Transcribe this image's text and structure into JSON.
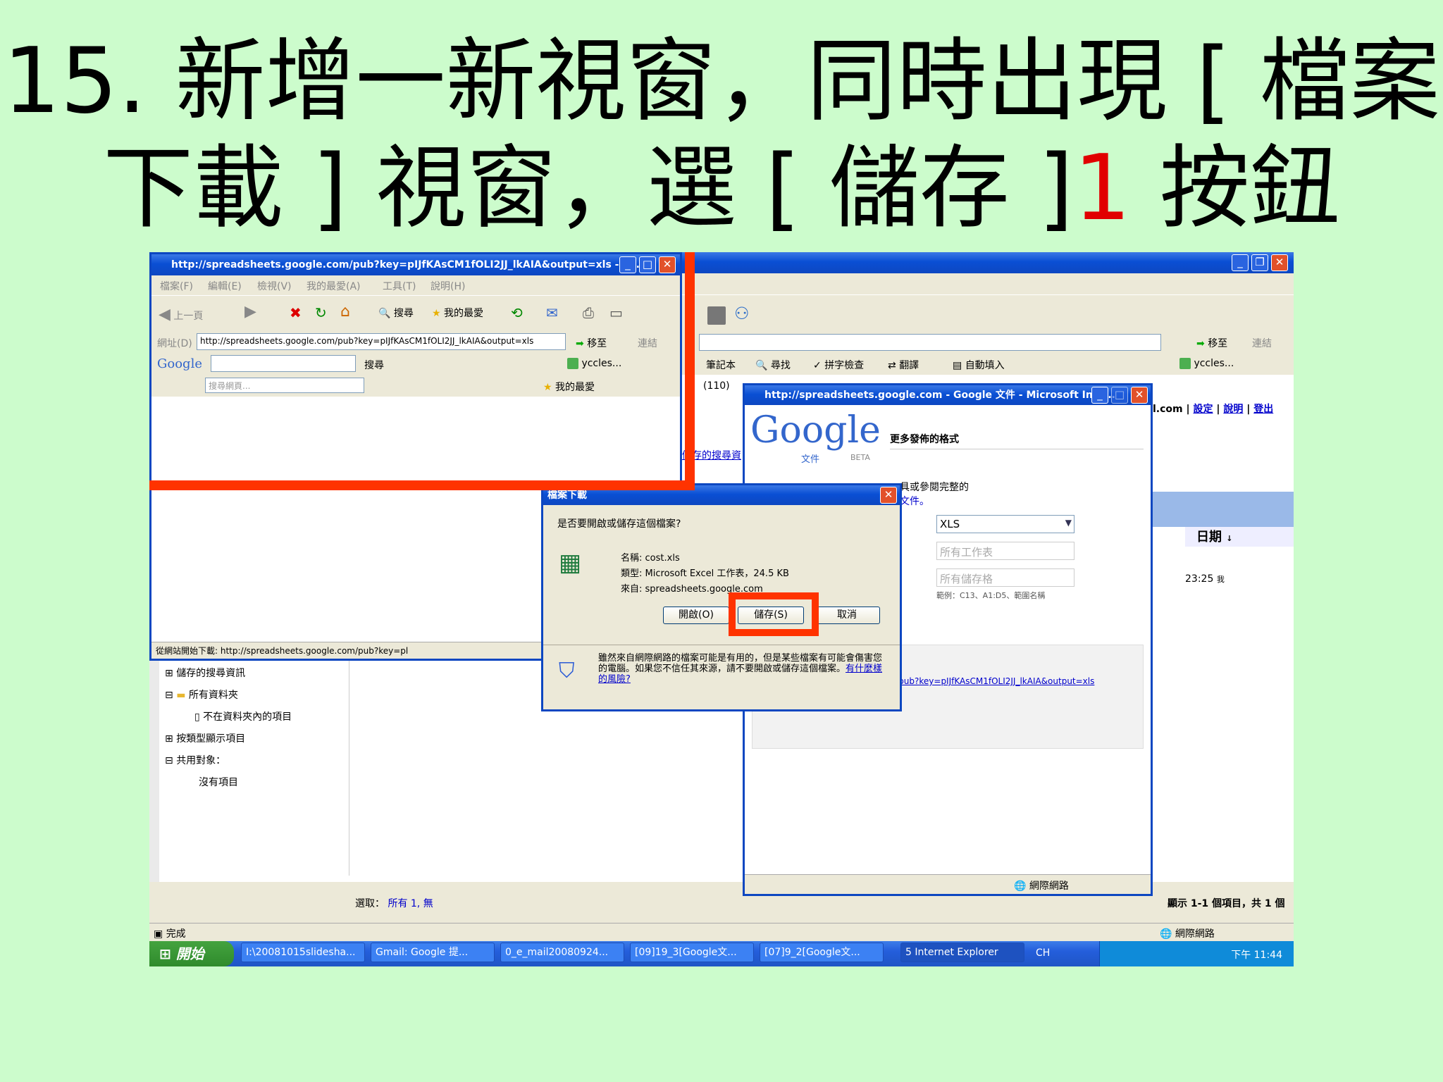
{
  "slide": {
    "title_line1": "15. 新增一新視窗，同時出現 [ 檔案",
    "title_line2_a": "下載 ] 視窗，選 [ 儲存 ]",
    "title_line2_num": "1",
    "title_line2_b": " 按鈕"
  },
  "ie_window": {
    "title": "http://spreadsheets.google.com/pub?key=pIJfKAsCM1fOLI2JJ_lkAIA&output=xls - M...",
    "menu": [
      "檔案(F)",
      "編輯(E)",
      "檢視(V)",
      "我的最愛(A)",
      "工具(T)",
      "說明(H)"
    ],
    "back_label": "上一頁",
    "search_label": "搜尋",
    "favorites_label": "我的最愛",
    "address_label": "網址(D)",
    "address_value": "http://spreadsheets.google.com/pub?key=pIJfKAsCM1fOLI2JJ_lkAIA&output=xls",
    "go_label": "移至",
    "links_label": "連結",
    "google_logo": "Google",
    "google_search_label": "搜尋",
    "profile_label": "yccles...",
    "search_web_placeholder": "搜尋網頁...",
    "fav2_label": "我的最愛",
    "status_text": "從網站開始下載: http://spreadsheets.google.com/pub?key=pl"
  },
  "back_window": {
    "go_label": "移至",
    "links_label": "連結",
    "notebook_label": "筆記本",
    "find_label": "尋找",
    "spell_label": "拼字檢查",
    "translate_label": "翻譯",
    "autofill_label": "自動填入",
    "profile_label": "yccles...",
    "inbox_count": "(110)",
    "account_text": "l.com |",
    "links": [
      "設定",
      "說明",
      "登出"
    ],
    "tree": {
      "saved_search_side": "儲存的搜尋資",
      "saved_search": "儲存的搜尋資訊",
      "all_folders": "所有資料夾",
      "not_in_folder": "不在資料夾內的項目",
      "by_type": "按類型顯示項目",
      "shared": "共用對象：",
      "no_items": "沒有項目"
    },
    "column_date": "日期",
    "row_time": "23:25",
    "row_suffix": "我",
    "select_label": "選取：",
    "select_all": "所有 1,",
    "select_none": "無",
    "footer_count": "顯示 1-1 個項目，共 1 個",
    "status_done": "完成",
    "status_zone": "網際網路"
  },
  "google_window": {
    "title": "http://spreadsheets.google.com - Google 文件 - Microsoft Inte...",
    "logo_text": "Google",
    "logo_sub": "文件",
    "logo_beta": "BETA",
    "heading": "更多發佈的格式",
    "partial_text1": "具或參閱完整的",
    "partial_text2": "文件。",
    "format_value": "XLS",
    "sheets_value": "所有工作表",
    "cells_value": "所有儲存格",
    "example": "範例：C13、A1:D5、範圍名稱",
    "url": "http://spreadsheets.google.com/pub?key=pIJfKAsCM1fOLI2JJ_lkAIA&output=xls",
    "status_zone": "網際網路"
  },
  "download_dialog": {
    "title": "檔案下載",
    "question": "是否要開啟或儲存這個檔案?",
    "name_label": "名稱:",
    "name_value": "cost.xls",
    "type_label": "類型:",
    "type_value": "Microsoft Excel 工作表，24.5 KB",
    "from_label": "來自:",
    "from_value": "spreadsheets.google.com",
    "open_button": "開啟(O)",
    "save_button": "儲存(S)",
    "cancel_button": "取消",
    "warning": "雖然來自網際網路的檔案可能是有用的，但是某些檔案有可能會傷害您的電腦。如果您不信任其來源，請不要開啟或儲存這個檔案。",
    "risk_link": "有什麼樣的風險?"
  },
  "taskbar": {
    "start": "開始",
    "items": [
      "I:\\20081015slidesha...",
      "Gmail: Google 提...",
      "0_e_mail20080924...",
      "[09]19_3[Google文...",
      "[07]9_2[Google文...",
      "5 Internet Explorer"
    ],
    "lang": "CH",
    "clock": "下午 11:44"
  },
  "colors": {
    "accent_red": "#ff3300",
    "xp_blue": "#0a4fd4",
    "slide_bg": "#ccfccc"
  }
}
